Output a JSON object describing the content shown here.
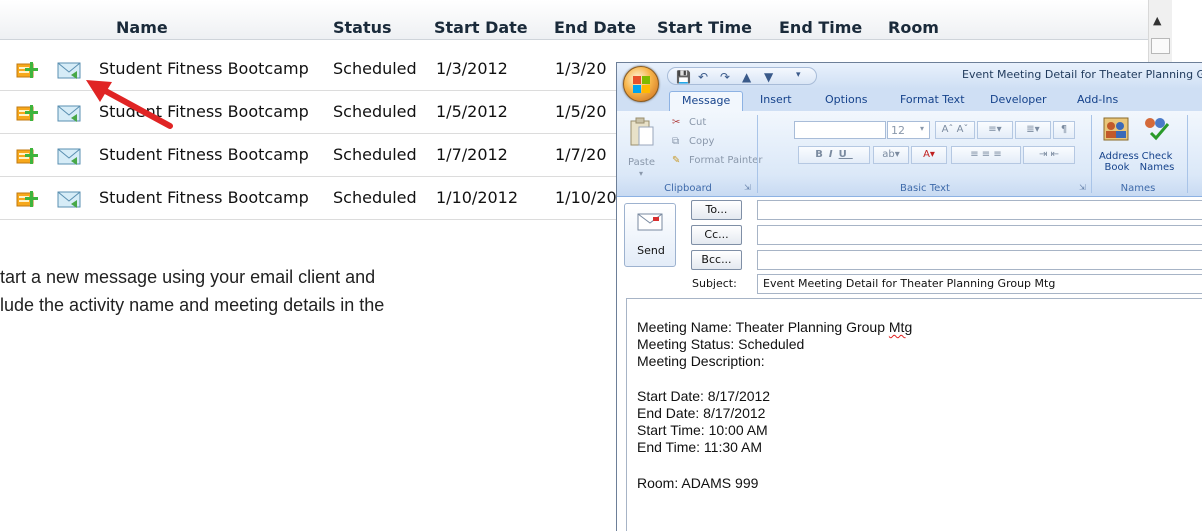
{
  "grid": {
    "columns": [
      "Name",
      "Status",
      "Start Date",
      "End Date",
      "Start Time",
      "End Time",
      "Room"
    ],
    "rows": [
      {
        "name": "Student Fitness Bootcamp",
        "status": "Scheduled",
        "start_date": "1/3/2012",
        "end_date": "1/3/20"
      },
      {
        "name": "Student Fitness Bootcamp",
        "status": "Scheduled",
        "start_date": "1/5/2012",
        "end_date": "1/5/20"
      },
      {
        "name": "Student Fitness Bootcamp",
        "status": "Scheduled",
        "start_date": "1/7/2012",
        "end_date": "1/7/20"
      },
      {
        "name": "Student Fitness Bootcamp",
        "status": "Scheduled",
        "start_date": "1/10/2012",
        "end_date": "1/10/20"
      }
    ],
    "row_icons": [
      "edit-icon",
      "email-icon"
    ]
  },
  "instructions": {
    "line1": "tart a new message using your email client and",
    "line2": "lude the activity name and meeting details in the"
  },
  "outlook": {
    "window_title": "Event Meeting Detail for Theater Planning G",
    "tabs": [
      "Message",
      "Insert",
      "Options",
      "Format Text",
      "Developer",
      "Add-Ins"
    ],
    "clipboard": {
      "paste": "Paste",
      "cut": "Cut",
      "copy": "Copy",
      "format_painter": "Format Painter",
      "label": "Clipboard"
    },
    "basic_text": {
      "font_size": "12",
      "label": "Basic Text"
    },
    "names": {
      "address_book_1": "Address",
      "address_book_2": "Book",
      "check_names_1": "Check",
      "check_names_2": "Names",
      "label": "Names"
    },
    "send_label": "Send",
    "to_label": "To...",
    "cc_label": "Cc...",
    "bcc_label": "Bcc...",
    "subject_label": "Subject:",
    "subject_value": "Event Meeting Detail for Theater Planning Group Mtg",
    "body": {
      "meeting_name_prefix": "Meeting Name: Theater Planning Group ",
      "meeting_name_word": "Mtg",
      "meeting_status": "Meeting Status: Scheduled",
      "meeting_description": "Meeting Description:",
      "start_date": "Start Date: 8/17/2012",
      "end_date": "End Date: 8/17/2012",
      "start_time": "Start Time: 10:00 AM",
      "end_time": "End Time: 11:30 AM",
      "room": "Room: ADAMS 999"
    }
  },
  "colors": {
    "arrow": "#e02424",
    "ribbon_text": "#15428b",
    "accent": "#f0a830"
  }
}
